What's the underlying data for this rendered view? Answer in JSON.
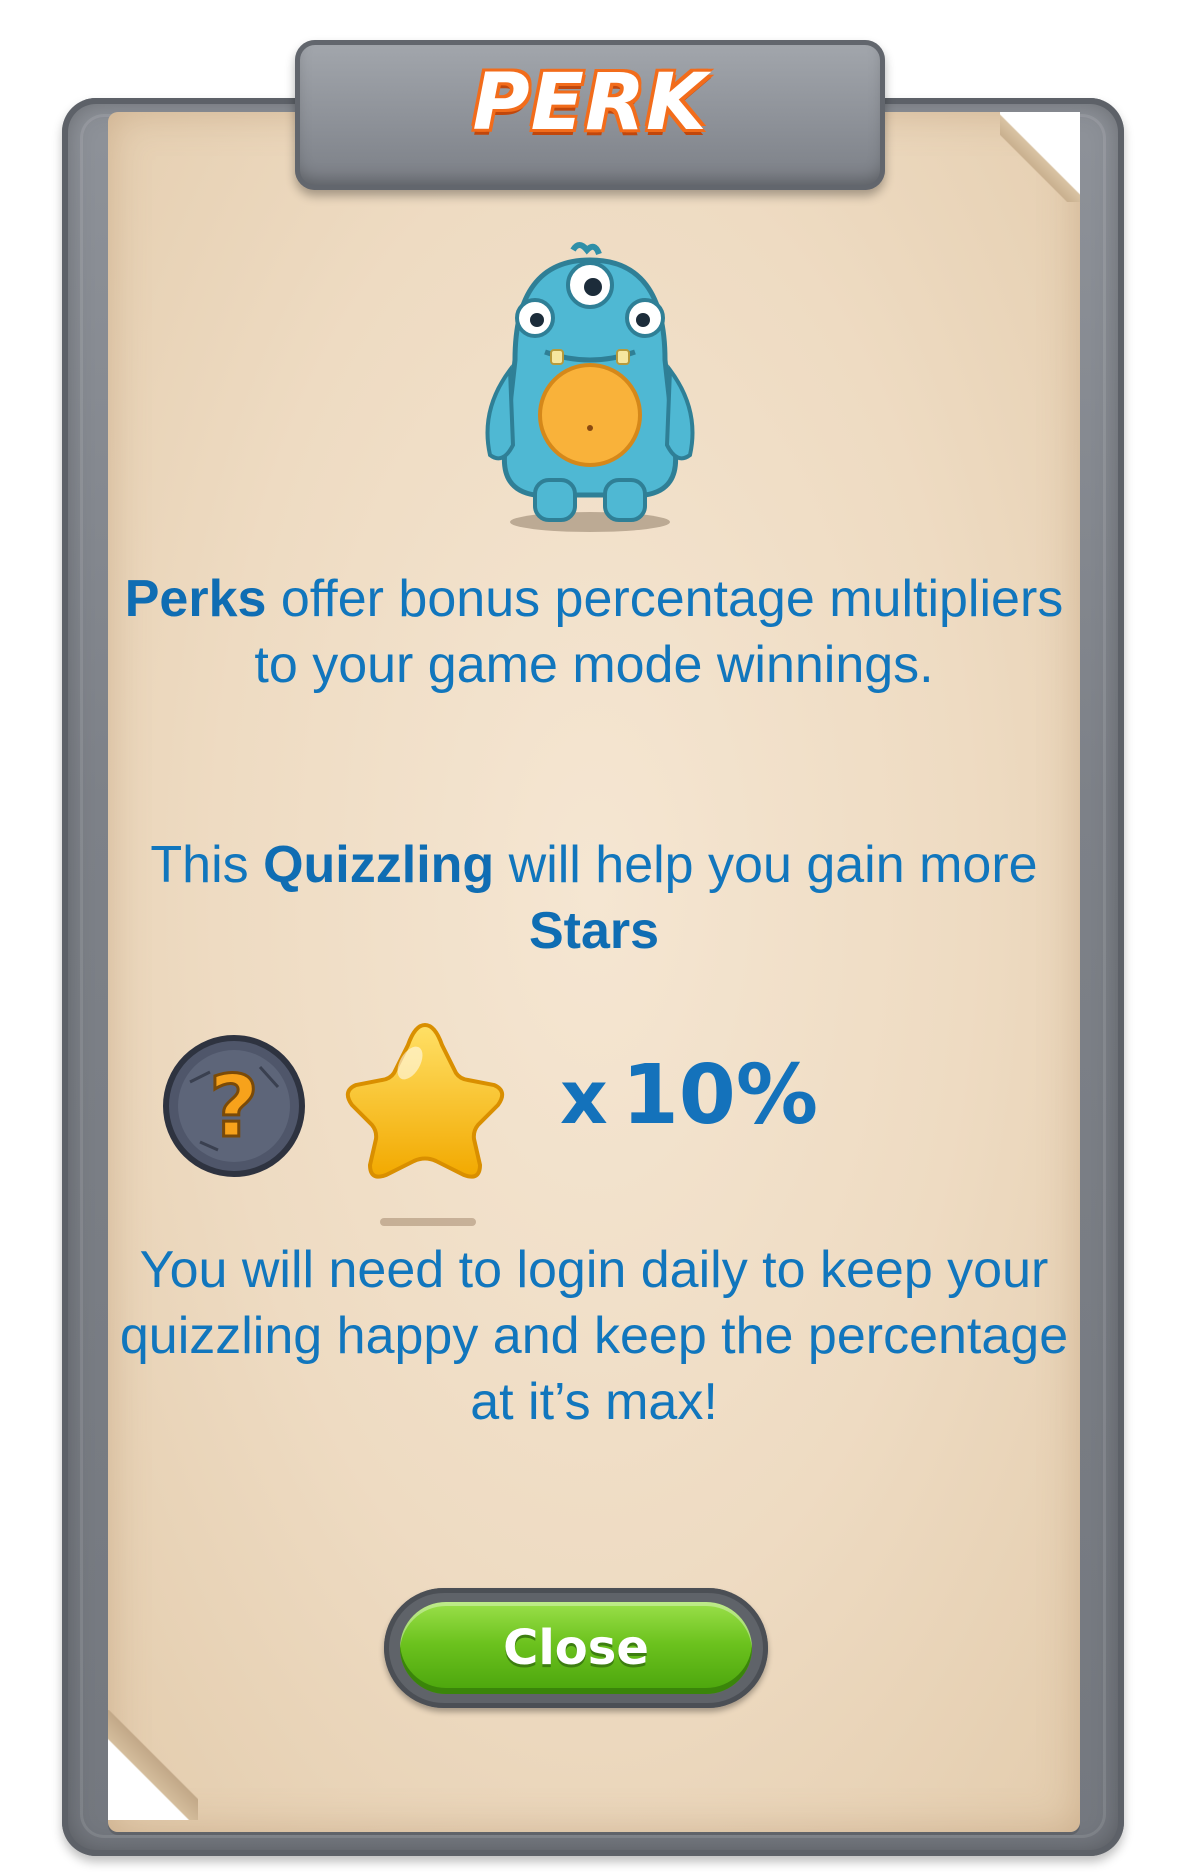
{
  "title": "PERK",
  "paragraph1": {
    "bold_lead": "Perks",
    "rest": " offer bonus percentage multipliers to your game mode winnings."
  },
  "paragraph2": {
    "part1": "This ",
    "bold1": "Quizzling",
    "part2": " will help you gain more ",
    "bold2": "Stars"
  },
  "reward": {
    "quizzling_icon": "question-mark-stone-icon",
    "reward_icon": "star-icon",
    "multiplier_x": "x",
    "multiplier_value": "10%"
  },
  "paragraph3": "You will need to login daily to keep your quizzling happy and keep the percentage at it’s max!",
  "close_button_label": "Close",
  "colors": {
    "text_blue": "#1176bd",
    "title_orange": "#f26c1b",
    "button_green": "#6cc21e",
    "parchment": "#eedbc2",
    "stone": "#7d8188"
  }
}
